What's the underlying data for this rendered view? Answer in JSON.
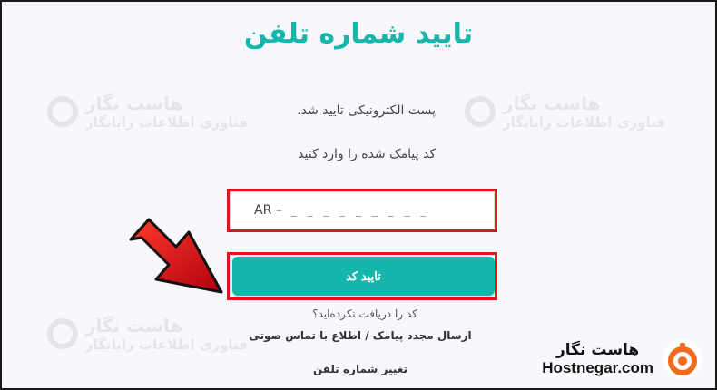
{
  "watermark": {
    "name": "هاست نگار",
    "tagline": "فناوری اطلاعات رایانگار"
  },
  "page": {
    "title": "تایید شماره تلفن",
    "email_confirmed": "پست الکترونیکی تایید شد.",
    "enter_code": "کد پیامک شده را وارد کنید"
  },
  "code_field": {
    "prefix": "AR –",
    "value_mask": "_ _ _ _ _ _ _ _ _"
  },
  "confirm_button": {
    "label": "تایید کد"
  },
  "resend": {
    "question": "کد را دریافت نکرده‌اید؟",
    "resend_link": "ارسال مجدد پیامک / اطلاع با تماس صوتی",
    "change_phone_link": "تغییر شماره تلفن"
  },
  "brand": {
    "name_fa": "هاست نگار",
    "name_en": "Hostnegar.com",
    "accent": "#f26a1b"
  },
  "colors": {
    "title": "#18b5ad",
    "button": "#17b6ad",
    "highlight": "#e0141c"
  }
}
